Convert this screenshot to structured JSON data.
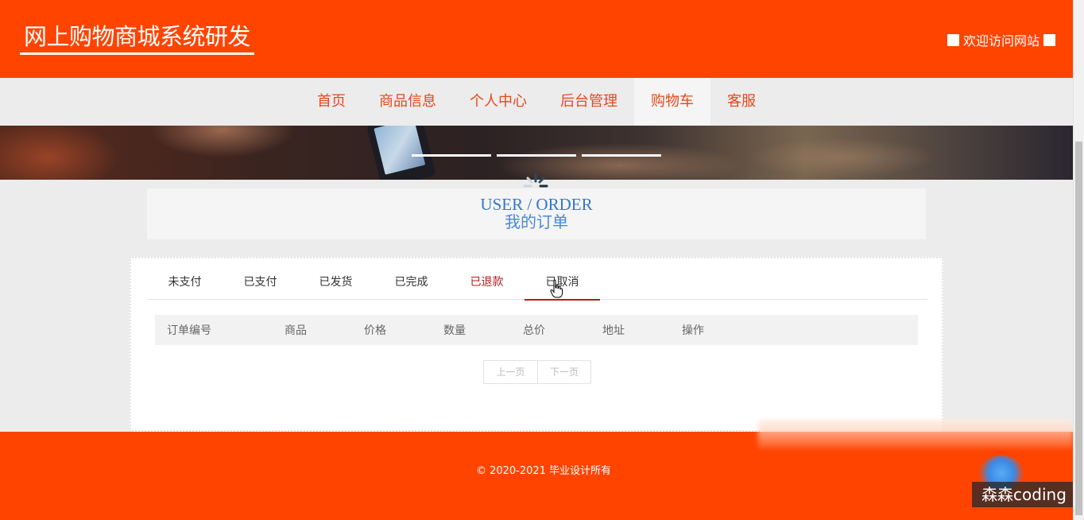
{
  "header": {
    "site_title": "网上购物商城系统研发",
    "welcome": "欢迎访问网站"
  },
  "nav": {
    "items": [
      {
        "label": "首页"
      },
      {
        "label": "商品信息"
      },
      {
        "label": "个人中心"
      },
      {
        "label": "后台管理"
      },
      {
        "label": "购物车"
      },
      {
        "label": "客服"
      }
    ],
    "active": "购物车"
  },
  "section_title": {
    "en": "USER / ORDER",
    "cn": "我的订单"
  },
  "order_tabs": {
    "items": [
      {
        "label": "未支付"
      },
      {
        "label": "已支付"
      },
      {
        "label": "已发货"
      },
      {
        "label": "已完成"
      },
      {
        "label": "已退款"
      },
      {
        "label": "已取消"
      }
    ],
    "active": "已取消"
  },
  "table": {
    "columns": [
      "订单编号",
      "商品",
      "价格",
      "数量",
      "总价",
      "地址",
      "操作"
    ]
  },
  "pager": {
    "prev": "上一页",
    "next": "下一页"
  },
  "footer": {
    "copyright": "© 2020-2021 毕业设计所有"
  },
  "watermark": "森森coding",
  "colors": {
    "brand": "#ff4400",
    "nav_text": "#e5491b",
    "title_blue": "#3377cc",
    "tab_active": "#b21d1d"
  }
}
